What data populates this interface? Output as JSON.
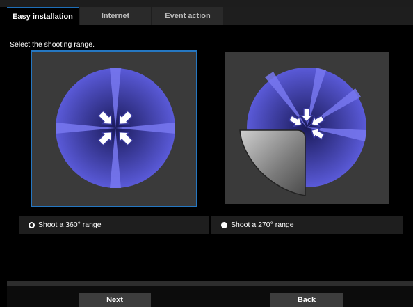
{
  "tabs": [
    {
      "label": "Easy installation",
      "active": true
    },
    {
      "label": "Internet",
      "active": false
    },
    {
      "label": "Event action",
      "active": false
    }
  ],
  "instruction": "Select the shooting range.",
  "options": [
    {
      "label": "Shoot a 360° range",
      "selected": true,
      "icon": "camera-360-icon"
    },
    {
      "label": "Shoot a 270° range",
      "selected": false,
      "icon": "camera-270-icon"
    }
  ],
  "buttons": {
    "next": "Next",
    "back": "Back"
  },
  "colors": {
    "accent_border": "#2577c2",
    "range_fill": "#5656d6",
    "panel_bg": "#3a3a3a"
  }
}
